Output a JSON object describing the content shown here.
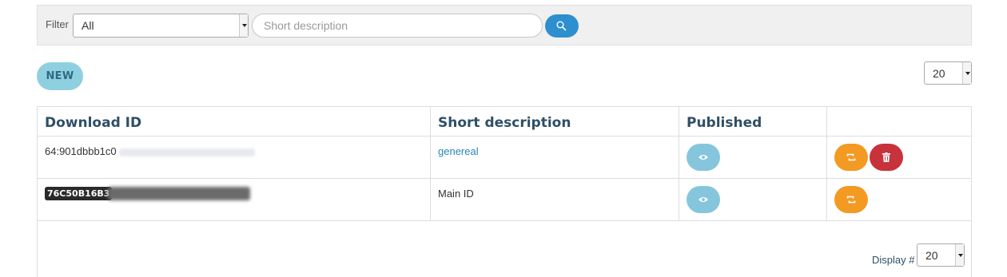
{
  "filter": {
    "label": "Filter",
    "selected": "All",
    "search_placeholder": "Short description",
    "search_icon": "search-icon"
  },
  "toolbar": {
    "new_label": "NEW",
    "page_size": "20"
  },
  "table": {
    "headers": [
      "Download ID",
      "Short description",
      "Published",
      ""
    ],
    "rows": [
      {
        "download_id": "64:901dbbb1c0",
        "description": "genereal",
        "published_icon": "eye-icon",
        "actions": [
          "refresh-icon",
          "trash-icon"
        ]
      },
      {
        "download_id": "76C50B16B3",
        "description": "Main ID",
        "published_icon": "eye-icon",
        "actions": [
          "refresh-icon"
        ]
      }
    ]
  },
  "footer": {
    "display_label": "Display #",
    "page_size": "20"
  },
  "colors": {
    "search_button": "#2e8fcf",
    "new_button": "#8fd0e0",
    "eye_button": "#86c6dc",
    "refresh_button": "#f39a23",
    "delete_button": "#c8323a",
    "header_text": "#2f4f66"
  }
}
